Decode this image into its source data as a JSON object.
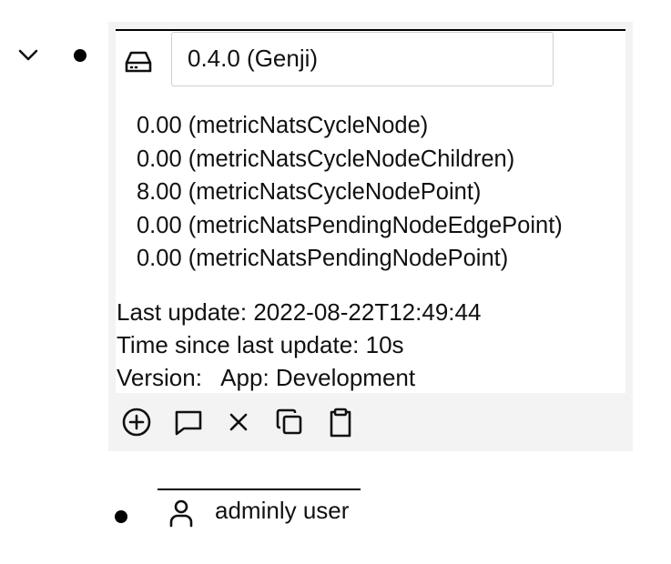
{
  "tree": {
    "expand_icon": "chevron-down-icon",
    "node": {
      "icon": "hard-drive-icon",
      "title": "0.4.0 (Genji)",
      "metrics": [
        "0.00 (metricNatsCycleNode)",
        "0.00 (metricNatsCycleNodeChildren)",
        "8.00 (metricNatsCycleNodePoint)",
        "0.00 (metricNatsPendingNodeEdgePoint)",
        "0.00 (metricNatsPendingNodePoint)"
      ],
      "last_update": "Last update: 2022-08-22T12:49:44",
      "time_since_update": "Time since last update: 10s",
      "version": "Version:   App: Development",
      "actions": [
        {
          "name": "add-icon"
        },
        {
          "name": "message-icon"
        },
        {
          "name": "close-icon"
        },
        {
          "name": "copy-icon"
        },
        {
          "name": "paste-icon"
        }
      ]
    },
    "child": {
      "icon": "user-icon",
      "label": "adminly user"
    }
  }
}
